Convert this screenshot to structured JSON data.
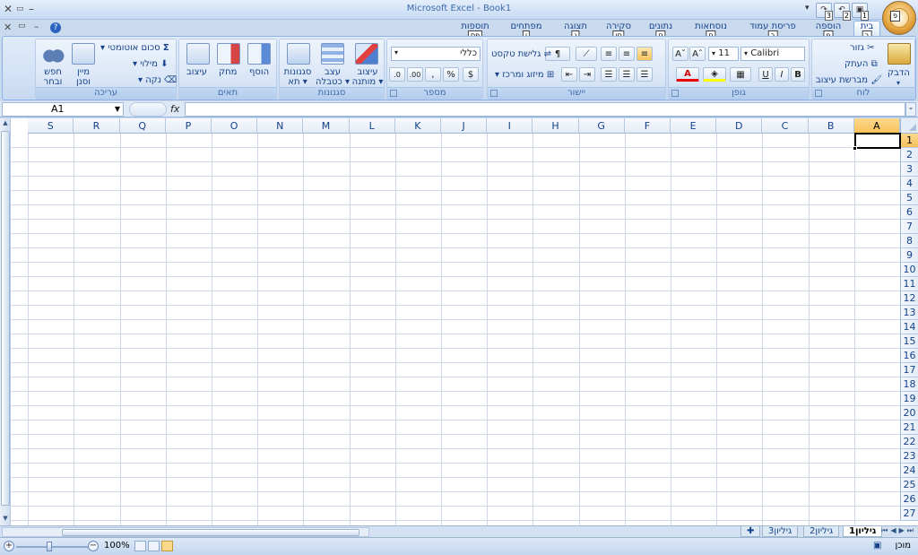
{
  "window": {
    "title": "Microsoft Excel - Book1",
    "colors": {
      "accent": "#15428b",
      "selected": "#f9c15b",
      "grid": "#d0d7e5"
    }
  },
  "qat": {
    "office_key": "פ",
    "save_key": "1",
    "undo_key": "2",
    "redo_key": "3"
  },
  "tabs": [
    {
      "label": "בית",
      "key": "ב",
      "active": true
    },
    {
      "label": "הוספה",
      "key": "פ"
    },
    {
      "label": "פריסת עמוד",
      "key": "ר"
    },
    {
      "label": "נוסחאות",
      "key": "ח"
    },
    {
      "label": "נתונים",
      "key": "ם"
    },
    {
      "label": "סקירה",
      "key": "סו"
    },
    {
      "label": "תצוגה",
      "key": "ג"
    },
    {
      "label": "מפתחים",
      "key": "ן"
    },
    {
      "label": "תוספות",
      "key": "פס"
    }
  ],
  "ribbon": {
    "clipboard": {
      "label": "לוח",
      "paste": "הדבק",
      "cut": "גזור",
      "copy": "העתק",
      "format_painter": "מברשת עיצוב"
    },
    "font": {
      "label": "גופן",
      "font_name": "Calibri",
      "font_size": "11",
      "bold": "B",
      "italic": "I",
      "underline": "U"
    },
    "alignment": {
      "label": "יישור",
      "wrap_text": "גלישת טקסט",
      "merge_center": "מיזוג ומרכז"
    },
    "number": {
      "label": "מספר",
      "format": "כללי",
      "percent": "%",
      "comma": ","
    },
    "styles": {
      "label": "סגנונות",
      "conditional_formatting": "עיצוב מותנה",
      "format_as_table": "עצב כטבלה",
      "cell_styles": "סגנונות תא"
    },
    "cells": {
      "label": "תאים",
      "insert": "הוסף",
      "delete": "מחק",
      "format": "עיצוב"
    },
    "editing": {
      "label": "עריכה",
      "autosum": "סכום אוטומטי",
      "fill": "מילוי",
      "clear": "נקה",
      "sort_filter": "מיין וסנן",
      "find_select": "חפש ובחר"
    }
  },
  "formula_bar": {
    "name_box": "A1",
    "fx": "fx",
    "value": ""
  },
  "grid": {
    "columns": [
      "A",
      "B",
      "C",
      "D",
      "E",
      "F",
      "G",
      "H",
      "I",
      "J",
      "K",
      "L",
      "M",
      "N",
      "O",
      "P",
      "Q",
      "R",
      "S"
    ],
    "rows": [
      "1",
      "2",
      "3",
      "4",
      "5",
      "6",
      "7",
      "8",
      "9",
      "10",
      "11",
      "12",
      "13",
      "14",
      "15",
      "16",
      "17",
      "18",
      "19",
      "20",
      "21",
      "22",
      "23",
      "24",
      "25",
      "26",
      "27"
    ],
    "active_cell": "A1"
  },
  "sheets": [
    {
      "label": "גיליון1",
      "active": true
    },
    {
      "label": "גיליון2"
    },
    {
      "label": "גיליון3"
    }
  ],
  "status": {
    "ready": "מוכן",
    "zoom": "100%"
  }
}
